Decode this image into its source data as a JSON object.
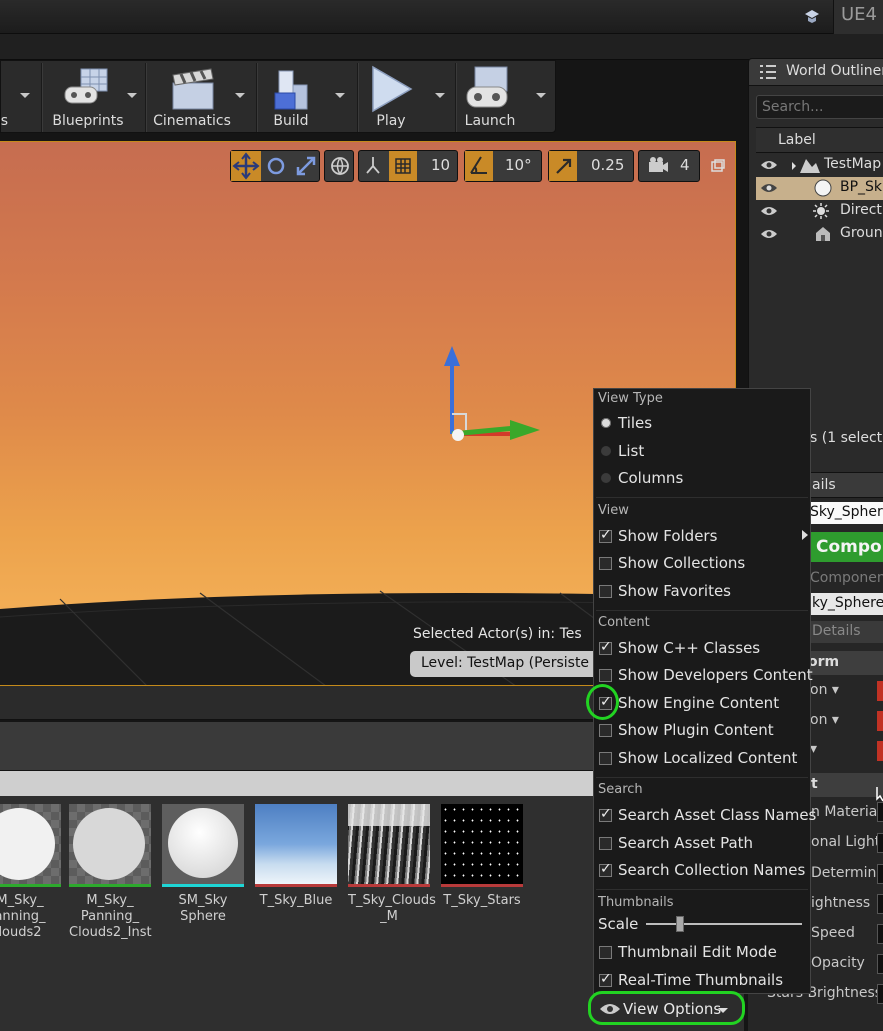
{
  "app": {
    "title_fragment": "UE4"
  },
  "toolbar": {
    "items": [
      {
        "label": "gs",
        "icon": "settings-icon"
      },
      {
        "label": "Blueprints",
        "icon": "blueprint-icon"
      },
      {
        "label": "Cinematics",
        "icon": "clapper-icon"
      },
      {
        "label": "Build",
        "icon": "build-icon"
      },
      {
        "label": "Play",
        "icon": "play-icon"
      },
      {
        "label": "Launch",
        "icon": "gamepad-icon"
      }
    ]
  },
  "viewport": {
    "grid_snap": "10",
    "rotation_snap": "10°",
    "scale_snap": "0.25",
    "camera_speed": "4",
    "selected_actors_text": "Selected Actor(s) in:  Tes",
    "level_text": "Level:  TestMap (Persiste"
  },
  "outliner": {
    "tab_title": "World Outliner",
    "search_placeholder": "Search...",
    "column_label": "Label",
    "rows": [
      {
        "label": "TestMap",
        "icon": "map-icon",
        "selected": false
      },
      {
        "label": "BP_Sk",
        "icon": "sphere-icon",
        "selected": true
      },
      {
        "label": "Directi",
        "icon": "light-icon",
        "selected": false
      },
      {
        "label": "Groun",
        "icon": "mesh-icon",
        "selected": false
      }
    ],
    "actors_count_text": "s (1 select"
  },
  "details": {
    "tab_title": "ails",
    "actor_name": "Sky_Sphere",
    "add_component": "Compon",
    "components_label": "Componen",
    "component_selected": "ky_Sphere",
    "search_placeholder": "Details",
    "transform_section": "orm",
    "transform_rows": [
      "on ▾",
      "on ▾",
      "▾"
    ],
    "default_section": "t",
    "default_rows": [
      "n Materia",
      "onal Light",
      "Determin",
      "ightness",
      "Speed",
      "Opacity",
      "Stars Brightness"
    ]
  },
  "content_browser": {
    "assets": [
      {
        "name": "M_Sky_\nanning_\nlouds2",
        "bar_color": "#2da92d"
      },
      {
        "name": "M_Sky_\nPanning_\nClouds2_Inst",
        "bar_color": "#2da92d"
      },
      {
        "name": "SM_Sky\nSphere",
        "bar_color": "#1fd6d6"
      },
      {
        "name": "T_Sky_Blue",
        "bar_color": "#b83a3a"
      },
      {
        "name": "T_Sky_Clouds\n_M",
        "bar_color": "#b83a3a"
      },
      {
        "name": "T_Sky_Stars",
        "bar_color": "#b83a3a"
      }
    ]
  },
  "view_options_menu": {
    "view_type_header": "View Type",
    "view_type_items": [
      {
        "label": "Tiles",
        "selected": true
      },
      {
        "label": "List",
        "selected": false
      },
      {
        "label": "Columns",
        "selected": false
      }
    ],
    "view_header": "View",
    "view_items": [
      {
        "label": "Show Folders",
        "checked": true,
        "submenu": true
      },
      {
        "label": "Show Collections",
        "checked": false
      },
      {
        "label": "Show Favorites",
        "checked": false
      }
    ],
    "content_header": "Content",
    "content_items": [
      {
        "label": "Show C++ Classes",
        "checked": true
      },
      {
        "label": "Show Developers Content",
        "checked": false
      },
      {
        "label": "Show Engine Content",
        "checked": true
      },
      {
        "label": "Show Plugin Content",
        "checked": false
      },
      {
        "label": "Show Localized Content",
        "checked": false
      }
    ],
    "search_header": "Search",
    "search_items": [
      {
        "label": "Search Asset Class Names",
        "checked": true
      },
      {
        "label": "Search Asset Path",
        "checked": false
      },
      {
        "label": "Search Collection Names",
        "checked": true
      }
    ],
    "thumbnails_header": "Thumbnails",
    "scale_label": "Scale",
    "scale_value": 0.2,
    "thumb_items": [
      {
        "label": "Thumbnail Edit Mode",
        "checked": false
      },
      {
        "label": "Real-Time Thumbnails",
        "checked": true
      }
    ]
  },
  "view_options_button": "View Options",
  "colors": {
    "highlight_ring": "#22d322",
    "viewport_border": "#c48a1a",
    "add_component": "#2e9c2e"
  }
}
